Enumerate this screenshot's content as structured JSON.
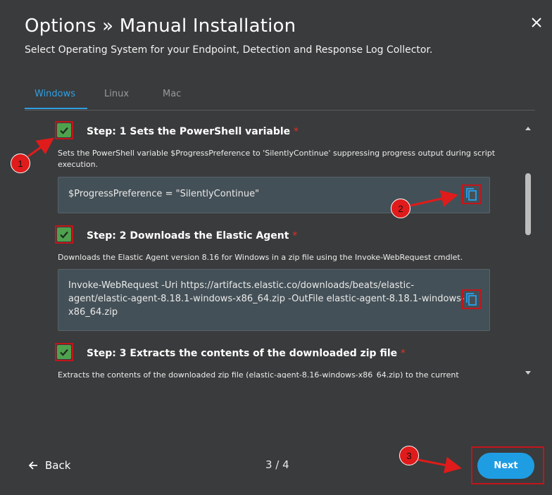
{
  "header": {
    "title": "Options » Manual Installation",
    "subtitle": "Select Operating System for your Endpoint, Detection and Response Log Collector.",
    "close_icon": "close-icon"
  },
  "tabs": [
    {
      "label": "Windows",
      "active": true
    },
    {
      "label": "Linux",
      "active": false
    },
    {
      "label": "Mac",
      "active": false
    }
  ],
  "steps": [
    {
      "title": "Step: 1 Sets the PowerShell variable",
      "required_mark": "*",
      "checked": true,
      "description": "Sets the PowerShell variable $ProgressPreference to 'SilentlyContinue' suppressing progress output during script execution.",
      "code": "$ProgressPreference = \"SilentlyContinue\""
    },
    {
      "title": "Step: 2 Downloads the Elastic Agent",
      "required_mark": "*",
      "checked": true,
      "description": "Downloads the Elastic Agent version 8.16 for Windows in a zip file using the Invoke-WebRequest cmdlet.",
      "code_lines": [
        "Invoke-WebRequest -Uri https://artifacts.elastic.co/downloads/beats/elastic-",
        "agent/elastic-agent-8.18.1-windows-x86_64.zip -OutFile elastic-agent-8.18.1-windows-",
        "x86_64.zip"
      ]
    },
    {
      "title": "Step: 3 Extracts the contents of the downloaded zip file",
      "required_mark": "*",
      "checked": true,
      "description": "Extracts the contents of the downloaded zip file (elastic-agent-8.16-windows-x86_64.zip) to the current"
    }
  ],
  "annotations": [
    "1",
    "2",
    "3"
  ],
  "footer": {
    "back_label": "Back",
    "page_indicator": "3 / 4",
    "next_label": "Next"
  },
  "colors": {
    "background": "#3a3b3c",
    "accent": "#1f9de3",
    "checkbox": "#4fa14e",
    "annotation_red": "#e01b1b",
    "code_background": "#445057"
  }
}
